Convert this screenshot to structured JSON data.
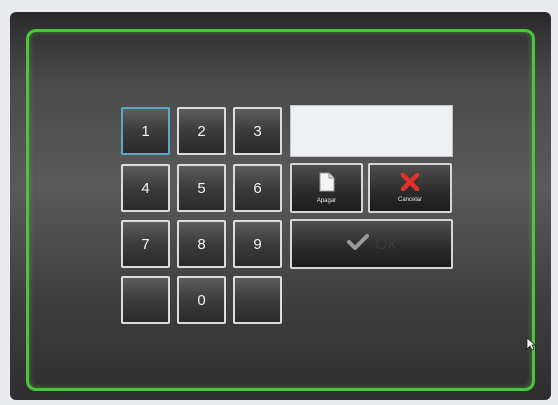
{
  "keypad": {
    "keys": [
      "1",
      "2",
      "3",
      "4",
      "5",
      "6",
      "7",
      "8",
      "9",
      "",
      "0",
      ""
    ]
  },
  "display": {
    "value": ""
  },
  "actions": {
    "erase_label": "Apagar",
    "cancel_label": "Cancelar",
    "ok_label": "Ok"
  },
  "colors": {
    "frame_accent": "#4cc43c",
    "cancel_icon": "#e0302a",
    "focus_border": "#5aa9c8"
  },
  "icons": {
    "erase": "document-icon",
    "cancel": "red-x-icon",
    "ok": "checkmark-icon"
  }
}
